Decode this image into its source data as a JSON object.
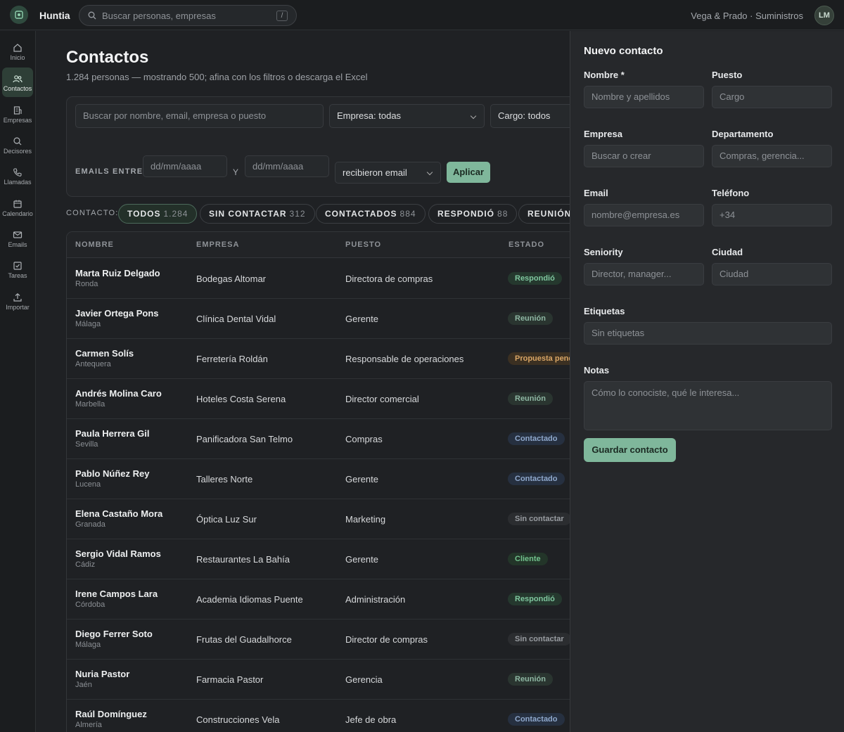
{
  "app": {
    "name": "Huntia",
    "org": "Vega & Prado · Suministros",
    "avatar": "LM"
  },
  "global_search": {
    "placeholder": "Buscar personas, empresas",
    "shortcut": "/"
  },
  "sidebar": {
    "items": [
      {
        "label": "Inicio",
        "icon": "home-icon"
      },
      {
        "label": "Contactos",
        "icon": "users-icon",
        "active": true
      },
      {
        "label": "Empresas",
        "icon": "building-icon"
      },
      {
        "label": "Decisores",
        "icon": "search-icon"
      },
      {
        "label": "Llamadas",
        "icon": "phone-icon"
      },
      {
        "label": "Calendario",
        "icon": "calendar-icon"
      },
      {
        "label": "Emails",
        "icon": "mail-icon"
      },
      {
        "label": "Tareas",
        "icon": "check-square-icon"
      },
      {
        "label": "Importar",
        "icon": "upload-icon"
      }
    ]
  },
  "page": {
    "title": "Contactos",
    "subtitle": "1.284 personas — mostrando 500; afina con los filtros o descarga el Excel"
  },
  "filters": {
    "search_placeholder": "Buscar por nombre, email, empresa o puesto",
    "empresa": "Empresa: todas",
    "cargo": "Cargo: todos",
    "emails_between_label": "EMAILS ENTRE",
    "date_from_placeholder": "dd/mm/aaaa",
    "and_label": "Y",
    "date_to_placeholder": "dd/mm/aaaa",
    "email_condition": "recibieron email",
    "apply_label": "Aplicar"
  },
  "contact_filter": {
    "label": "CONTACTO:",
    "chips": [
      {
        "label": "TODOS",
        "count": "1.284",
        "active": true
      },
      {
        "label": "SIN CONTACTAR",
        "count": "312"
      },
      {
        "label": "CONTACTADOS",
        "count": "884"
      },
      {
        "label": "RESPONDIÓ",
        "count": "88"
      },
      {
        "label": "REUNIÓN",
        "count": ""
      }
    ]
  },
  "table": {
    "columns": [
      "NOMBRE",
      "EMPRESA",
      "PUESTO",
      "ESTADO"
    ],
    "rows": [
      {
        "name": "Marta Ruiz Delgado",
        "city": "Ronda",
        "company": "Bodegas Altomar",
        "position": "Directora de compras",
        "status": "Respondió",
        "status_kind": "resp"
      },
      {
        "name": "Javier Ortega Pons",
        "city": "Málaga",
        "company": "Clínica Dental Vidal",
        "position": "Gerente",
        "status": "Reunión",
        "status_kind": "reun"
      },
      {
        "name": "Carmen Solís",
        "city": "Antequera",
        "company": "Ferretería Roldán",
        "position": "Responsable de operaciones",
        "status": "Propuesta pend",
        "status_kind": "prop"
      },
      {
        "name": "Andrés Molina Caro",
        "city": "Marbella",
        "company": "Hoteles Costa Serena",
        "position": "Director comercial",
        "status": "Reunión",
        "status_kind": "reun"
      },
      {
        "name": "Paula Herrera Gil",
        "city": "Sevilla",
        "company": "Panificadora San Telmo",
        "position": "Compras",
        "status": "Contactado",
        "status_kind": "cont"
      },
      {
        "name": "Pablo Núñez Rey",
        "city": "Lucena",
        "company": "Talleres Norte",
        "position": "Gerente",
        "status": "Contactado",
        "status_kind": "cont"
      },
      {
        "name": "Elena Castaño Mora",
        "city": "Granada",
        "company": "Óptica Luz Sur",
        "position": "Marketing",
        "status": "Sin contactar",
        "status_kind": "sin"
      },
      {
        "name": "Sergio Vidal Ramos",
        "city": "Cádiz",
        "company": "Restaurantes La Bahía",
        "position": "Gerente",
        "status": "Cliente",
        "status_kind": "cli"
      },
      {
        "name": "Irene Campos Lara",
        "city": "Córdoba",
        "company": "Academia Idiomas Puente",
        "position": "Administración",
        "status": "Respondió",
        "status_kind": "resp"
      },
      {
        "name": "Diego Ferrer Soto",
        "city": "Málaga",
        "company": "Frutas del Guadalhorce",
        "position": "Director de compras",
        "status": "Sin contactar",
        "status_kind": "sin"
      },
      {
        "name": "Nuria Pastor",
        "city": "Jaén",
        "company": "Farmacia Pastor",
        "position": "Gerencia",
        "status": "Reunión",
        "status_kind": "reun"
      },
      {
        "name": "Raúl Domínguez",
        "city": "Almería",
        "company": "Construcciones Vela",
        "position": "Jefe de obra",
        "status": "Contactado",
        "status_kind": "cont"
      }
    ]
  },
  "new_contact": {
    "title": "Nuevo contacto",
    "fields": [
      {
        "label": "Nombre *",
        "placeholder": "Nombre y apellidos"
      },
      {
        "label": "Puesto",
        "placeholder": "Cargo"
      },
      {
        "label": "Empresa",
        "placeholder": "Buscar o crear"
      },
      {
        "label": "Departamento",
        "placeholder": "Compras, gerencia..."
      },
      {
        "label": "Email",
        "placeholder": "nombre@empresa.es"
      },
      {
        "label": "Teléfono",
        "placeholder": "+34"
      },
      {
        "label": "Seniority",
        "placeholder": "Director, manager..."
      },
      {
        "label": "Ciudad",
        "placeholder": "Ciudad"
      },
      {
        "label": "Etiquetas",
        "placeholder": "Sin etiquetas"
      },
      {
        "label": "Notas",
        "placeholder": "Cómo lo conociste, qué le interesa..."
      }
    ],
    "save_label": "Guardar contacto"
  },
  "colors": {
    "accent": "#7fb79b",
    "background": "#1f2124",
    "panel": "#26282b"
  }
}
